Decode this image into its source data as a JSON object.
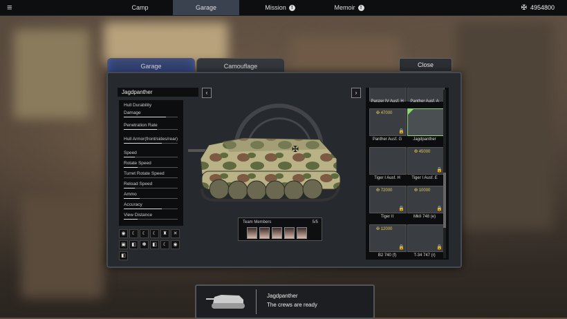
{
  "topbar": {
    "tabs": [
      "Camp",
      "Garage",
      "Mission",
      "Memoir"
    ],
    "active_tab": "Garage",
    "info_glyph": "!",
    "currency": "4954800"
  },
  "panel": {
    "tabs": [
      "Garage",
      "Camouflage"
    ],
    "close_label": "Close",
    "tank_name": "Jagdpanther",
    "stats": [
      {
        "label": "Hull Durability",
        "fill": 0
      },
      {
        "label": "Damage",
        "fill": 0.78
      },
      {
        "label": "Penetration Rate",
        "fill": 0.62
      },
      {
        "label": "Hull Armor(front/sides/rear)",
        "fill": 0.7
      },
      {
        "label": "Speed",
        "fill": 0.2
      },
      {
        "label": "Rotate Speed",
        "fill": 0.25
      },
      {
        "label": "Turret Rotate Speed",
        "fill": 0.0
      },
      {
        "label": "Reload Speed",
        "fill": 0.2
      },
      {
        "label": "Ammo",
        "fill": 0.3
      },
      {
        "label": "Accuracy",
        "fill": 0.7
      },
      {
        "label": "View Distance",
        "fill": 0.25
      }
    ],
    "team": {
      "label": "Team Members",
      "count": "5/5"
    }
  },
  "tanks": [
    {
      "name": "Panzer IV Ausf. H",
      "price": ""
    },
    {
      "name": "Panther Ausf. A",
      "price": ""
    },
    {
      "name": "Panther Ausf. G",
      "price": "47000"
    },
    {
      "name": "Jagdpanther",
      "price": ""
    },
    {
      "name": "Tiger I Ausf. H",
      "price": ""
    },
    {
      "name": "Tiger I Ausf. E",
      "price": "45000"
    },
    {
      "name": "Tiger II",
      "price": "72000"
    },
    {
      "name": "MkII 748 (e)",
      "price": "10000"
    },
    {
      "name": "B2 740 (f)",
      "price": "12000"
    },
    {
      "name": "T-34 747 (r)",
      "price": ""
    }
  ],
  "bottom": {
    "name": "Jagdpanther",
    "status": "The crews are ready"
  },
  "colors": {
    "accent": "#8fd96a",
    "price": "#e4c75a"
  }
}
